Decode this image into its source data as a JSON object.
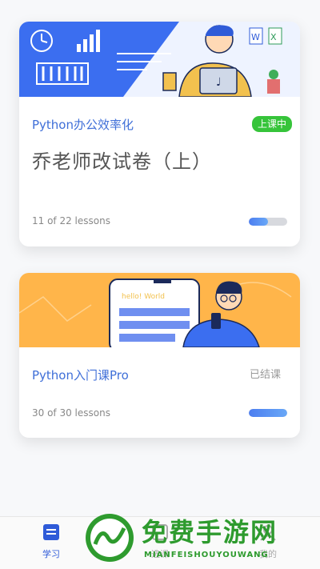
{
  "courses": [
    {
      "name": "Python办公效率化",
      "status": "上课中",
      "lesson_title": "乔老师改试卷（上）",
      "progress_text": "11 of 22 lessons",
      "progress": 0.5
    },
    {
      "name": "Python入门课Pro",
      "status": "已结课",
      "progress_text": "30 of 30 lessons",
      "progress": 1.0,
      "banner_text": "hello! World"
    }
  ],
  "tabbar": {
    "items": [
      {
        "label": "学习",
        "icon": "book-icon",
        "active": true
      },
      {
        "label": "选课",
        "icon": "course-icon",
        "active": false
      },
      {
        "label": "我的",
        "icon": "user-icon",
        "active": false
      }
    ]
  },
  "watermark": {
    "title": "免费手游网",
    "subtitle": "MIANFEISHOUYOUWANG"
  },
  "colors": {
    "accent": "#3f6fd8",
    "badge_green": "#36c43a",
    "banner_blue": "#3b6ef0",
    "banner_orange": "#ffb54a",
    "watermark_green": "#2e9b2e"
  }
}
